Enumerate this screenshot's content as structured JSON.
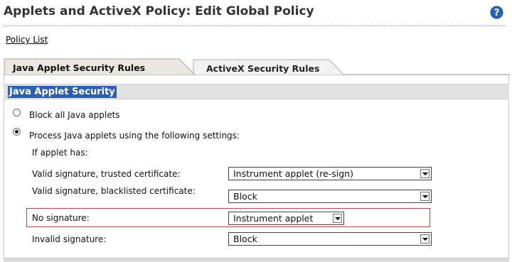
{
  "page": {
    "title": "Applets and ActiveX Policy: Edit Global Policy",
    "help_icon": "help-icon",
    "policy_list_link": "Policy List"
  },
  "tabs": [
    {
      "label": "Java Applet Security Rules",
      "active": true
    },
    {
      "label": "ActiveX Security Rules",
      "active": false
    }
  ],
  "section": {
    "title": "Java Applet Security"
  },
  "options": {
    "block_all": {
      "label": "Block all Java applets",
      "selected": false
    },
    "process": {
      "label": "Process Java applets using the following settings:",
      "selected": true
    }
  },
  "if_applet_has": "If applet has:",
  "rules": [
    {
      "label": "Valid signature, trusted certificate:",
      "value": "Instrument applet (re-sign)"
    },
    {
      "label": "Valid signature, blacklisted certificate:",
      "value": "Block"
    },
    {
      "label": "No signature:",
      "value": "Instrument applet"
    },
    {
      "label": "Invalid signature:",
      "value": "Block"
    }
  ],
  "colors": {
    "section_title_bg": "#2f5fa8",
    "help_icon": "#2a63b8",
    "highlight_border": "#a44a4a"
  }
}
